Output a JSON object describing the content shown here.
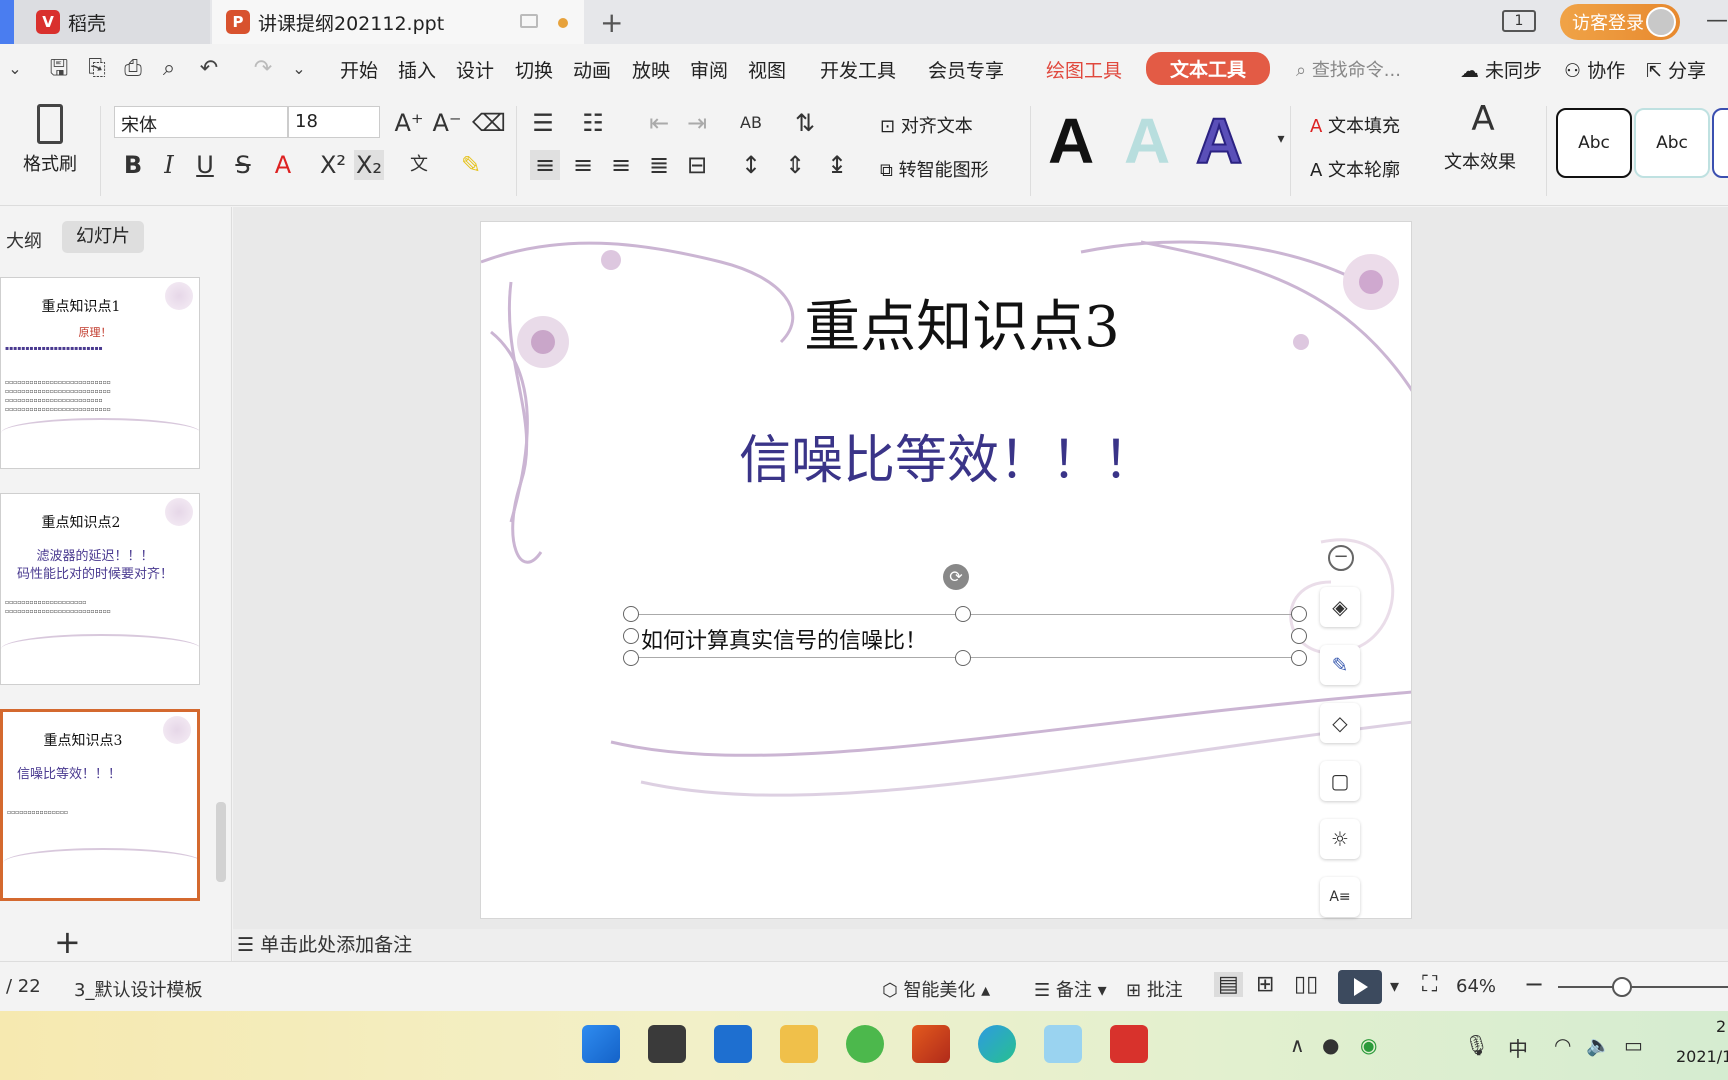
{
  "tabs": {
    "daoke_label": "稻壳",
    "file_label": "讲课提纲202112.ppt",
    "add_icon": "+"
  },
  "titlebar": {
    "counter": "1",
    "visitor_login": "访客登录"
  },
  "menu": {
    "items": [
      "开始",
      "插入",
      "设计",
      "切换",
      "动画",
      "放映",
      "审阅",
      "视图",
      "开发工具",
      "会员专享"
    ],
    "draw_tools": "绘图工具",
    "text_tools": "文本工具",
    "search_placeholder": "查找命令...",
    "not_synced": "未同步",
    "collaborate": "协作",
    "share": "分享"
  },
  "ribbon": {
    "format_painter": "格式刷",
    "font_name": "宋体",
    "font_size": "18",
    "align_text": "对齐文本",
    "smart_shape": "转智能图形",
    "text_fill": "文本填充",
    "text_outline": "文本轮廓",
    "text_effect": "文本效果",
    "style_letter": "A",
    "abc": "Abc",
    "colors": {
      "accent": "#e35b45",
      "draw_tools": "#e0483d",
      "active_slide_border": "#d4692f"
    }
  },
  "left_panel": {
    "tab_outline": "大纲",
    "tab_slides": "幻灯片",
    "thumbs": [
      {
        "title": "重点知识点1",
        "sub": "原理！",
        "sub2": ""
      },
      {
        "title": "重点知识点2",
        "sub": "滤波器的延迟！！！",
        "sub2": "码性能比对的时候要对齐！"
      },
      {
        "title": "重点知识点3",
        "sub": "信噪比等效！！！",
        "sub2": ""
      }
    ]
  },
  "slide": {
    "title": "重点知识点3",
    "subtitle": "信噪比等效！！！",
    "textbox": "如何计算真实信号的信噪比！"
  },
  "notes": {
    "placeholder": "单击此处添加备注"
  },
  "status": {
    "page": "/ 22",
    "template": "3_默认设计模板",
    "smart_beautify": "智能美化",
    "notes": "备注",
    "comments": "批注",
    "zoom": "64%"
  },
  "taskbar": {
    "ime": "中",
    "clock_line1": "2",
    "clock_line2": "2021/1"
  }
}
